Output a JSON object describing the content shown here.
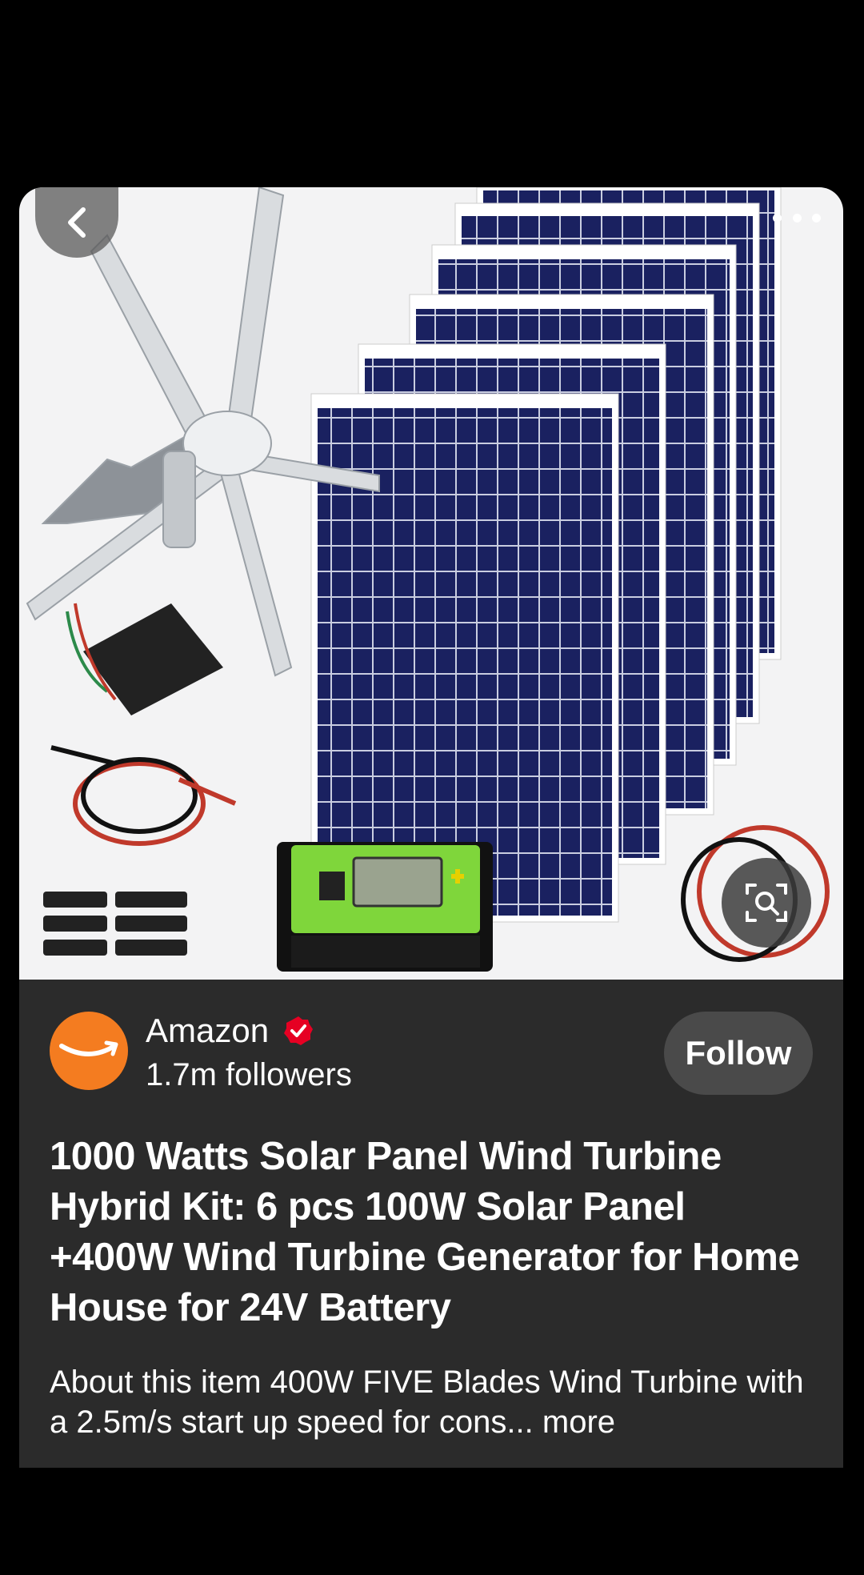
{
  "product": {
    "title": "1000 Watts Solar Panel Wind Turbine Hybrid Kit: 6 pcs 100W Solar Panel +400W Wind Turbine Generator for Home House for 24V Battery",
    "description": "About this item 400W FIVE Blades Wind Turbine with a 2.5m/s start up speed for cons...",
    "more_label": "more"
  },
  "seller": {
    "name": "Amazon",
    "followers": "1.7m followers",
    "follow_label": "Follow",
    "avatar_color": "#f47c20",
    "verified_color": "#e60023"
  },
  "icons": {
    "back": "chevron-left-icon",
    "more": "more-horizontal-icon",
    "lens": "visual-search-icon"
  },
  "colors": {
    "background": "#000000",
    "card": "#2b2b2b",
    "follow_button": "#4a4a4a"
  }
}
